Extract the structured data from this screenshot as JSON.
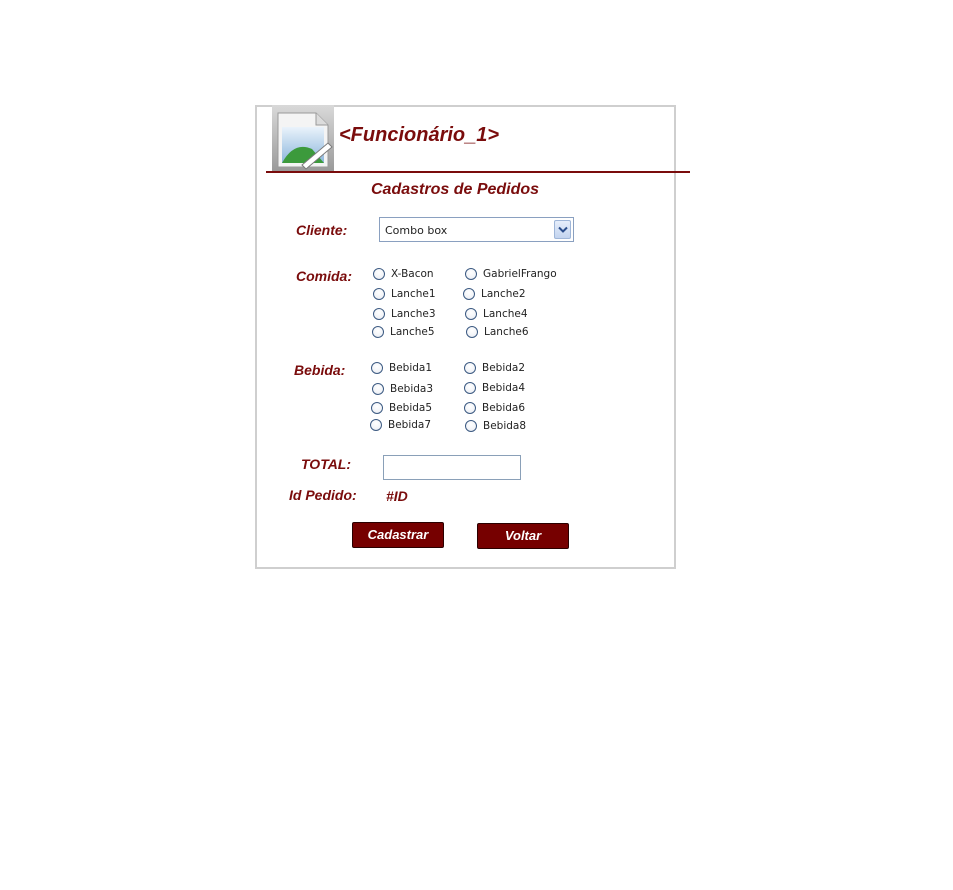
{
  "header": {
    "title": "<Funcionário_1>",
    "image_icon": "image-placeholder-icon"
  },
  "form": {
    "section_title": "Cadastros de Pedidos",
    "cliente": {
      "label": "Cliente:",
      "value": "Combo box",
      "dropdown_icon": "chevron-down-icon"
    },
    "comida": {
      "label": "Comida:",
      "options": [
        "X-Bacon",
        "GabrielFrango",
        "Lanche1",
        "Lanche2",
        "Lanche3",
        "Lanche4",
        "Lanche5",
        "Lanche6"
      ]
    },
    "bebida": {
      "label": "Bebida:",
      "options": [
        "Bebida1",
        "Bebida2",
        "Bebida3",
        "Bebida4",
        "Bebida5",
        "Bebida6",
        "Bebida7",
        "Bebida8"
      ]
    },
    "total": {
      "label": "TOTAL:",
      "value": ""
    },
    "id_pedido": {
      "label": "Id Pedido:",
      "value": "#ID"
    }
  },
  "buttons": {
    "cadastrar": "Cadastrar",
    "voltar": "Voltar"
  },
  "colors": {
    "accent": "#7a0c0c",
    "button_bg": "#760000",
    "panel_border": "#cfcfcf"
  }
}
